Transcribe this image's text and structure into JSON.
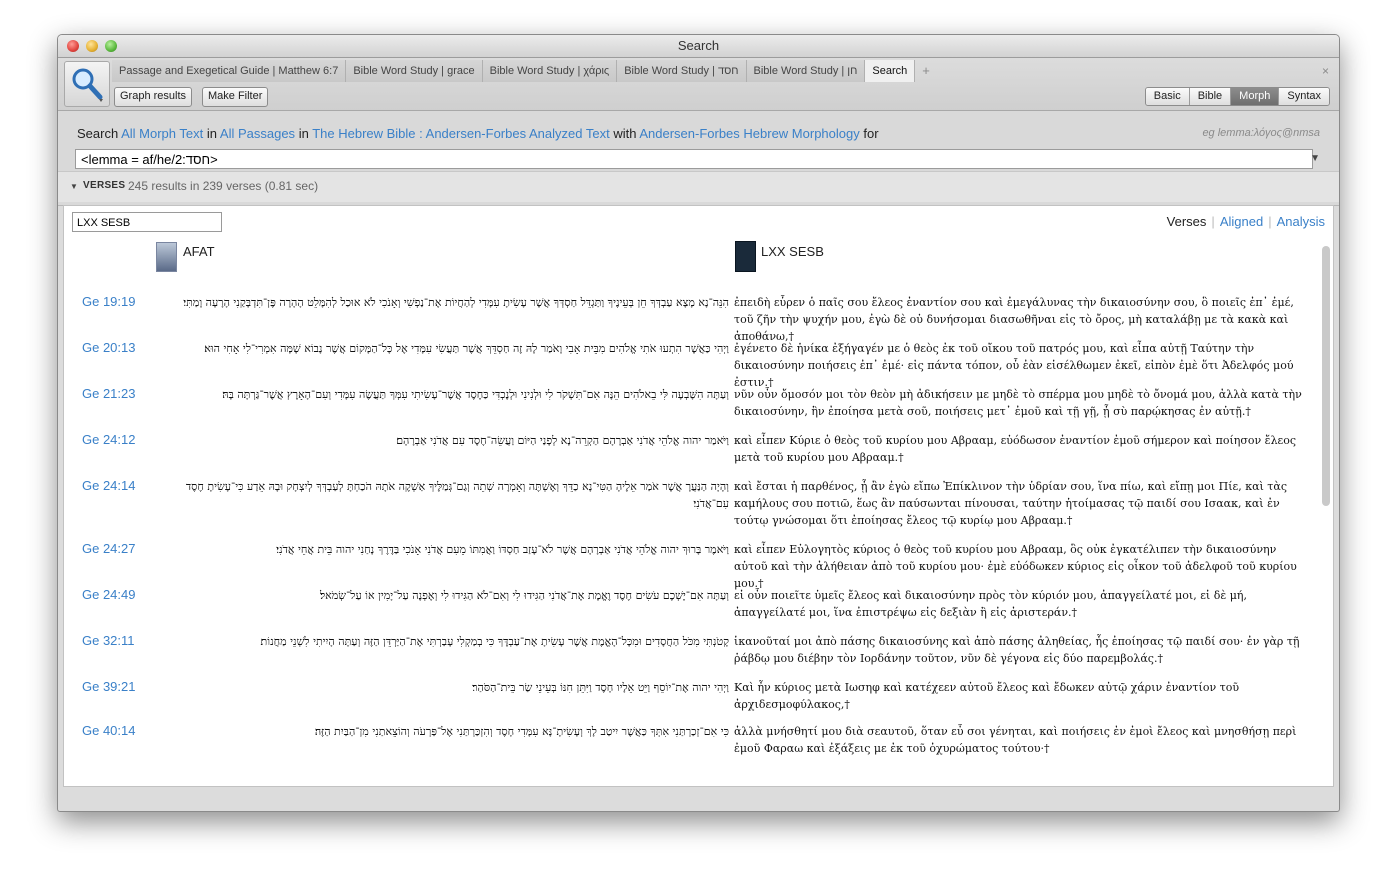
{
  "window": {
    "title": "Search"
  },
  "tabs": [
    {
      "label": "Passage and Exegetical Guide | Matthew 6:7"
    },
    {
      "label": "Bible Word Study | grace"
    },
    {
      "label": "Bible Word Study | χάρις"
    },
    {
      "label": "Bible Word Study | חסד"
    },
    {
      "label": "Bible Word Study | חן"
    },
    {
      "label": "Search"
    }
  ],
  "tab_add": "+",
  "tab_close": "×",
  "toolbar": {
    "graph_results": "Graph results",
    "make_filter": "Make Filter"
  },
  "search_types": [
    "Basic",
    "Bible",
    "Morph",
    "Syntax"
  ],
  "query": {
    "search": "Search",
    "target": "All Morph Text",
    "in": "in",
    "range": "All Passages",
    "in2": "in",
    "resource": "The Hebrew Bible : Andersen-Forbes Analyzed Text",
    "with": "with",
    "morphology": "Andersen-Forbes Hebrew Morphology",
    "for": "for",
    "example": "eg lemma:λόγος@nmsa",
    "value": "<lemma = af/he/2:חסד>"
  },
  "verses": {
    "label": "VERSES",
    "count": "245 results in 239 verses (0.81 sec)"
  },
  "filter_value": "LXX SESB",
  "views": {
    "verses": "Verses",
    "aligned": "Aligned",
    "analysis": "Analysis"
  },
  "columns": {
    "afat": "AFAT",
    "lxx": "LXX SESB"
  },
  "rows": [
    {
      "ref": "Ge 19:19",
      "heb": "הִנֵּה־נָא מָצָא עַבְדְּךָ חֵן בְּעֵינֶיךָ וַתַּגְדֵּל חַסְדְּךָ אֲשֶׁר עָשִׂיתָ עִמָּדִי לְהַחֲיוֹת אֶת־נַפְשִׁי וְאָנֹכִי לֹא אוּכַל לְהִמָּלֵט הָהָרָה פֶּן־תִּדְבָּקַנִי הָרָעָה וָמַתִּי׃",
      "grk": "ἐπειδὴ εὗρεν ὁ παῖς σου ἔλεος ἐναντίον σου καὶ ἐμεγάλυνας τὴν δικαιοσύνην σου, ὃ ποιεῖς ἐπ᾽ ἐμέ, τοῦ ζῆν τὴν ψυχήν μου, ἐγὼ δὲ οὐ δυνήσομαι διασωθῆναι εἰς τὸ ὄρος, μὴ καταλάβῃ με τὰ κακὰ καὶ ἀποθάνω,†"
    },
    {
      "ref": "Ge 20:13",
      "heb": "וַיְהִי כַּאֲשֶׁר הִתְעוּ אֹתִי אֱלֹהִים מִבֵּית אָבִי וָאֹמַר לָהּ זֶה חַסְדֵּךְ אֲשֶׁר תַּעֲשִׂי עִמָּדִי אֶל כָּל־הַמָּקוֹם אֲשֶׁר נָבוֹא שָׁמָּה אִמְרִי־לִי אָחִי הוּא׃",
      "grk": "ἐγένετο δὲ ἡνίκα ἐξήγαγέν με ὁ θεὸς ἐκ τοῦ οἴκου τοῦ πατρός μου, καὶ εἶπα αὐτῇ Ταύτην τὴν δικαιοσύνην ποιήσεις ἐπ᾽ ἐμέ· εἰς πάντα τόπον, οὗ ἐὰν εἰσέλθωμεν ἐκεῖ, εἰπὸν ἐμὲ ὅτι Ἀδελφός μού ἐστιν.†"
    },
    {
      "ref": "Ge 21:23",
      "heb": "וְעַתָּה הִשָּׁבְעָה לִּי בֵאלֹהִים הֵנָּה אִם־תִּשְׁקֹר לִי וּלְנִינִי וּלְנֶכְדִּי כַּחֶסֶד אֲשֶׁר־עָשִׂיתִי עִמְּךָ תַּעֲשֶׂה עִמָּדִי וְעִם־הָאָרֶץ אֲשֶׁר־גַּרְתָּה בָּהּ׃",
      "grk": "νῦν οὖν ὄμοσόν μοι τὸν θεὸν μὴ ἀδικήσειν με μηδὲ τὸ σπέρμα μου μηδὲ τὸ ὄνομά μου, ἀλλὰ κατὰ τὴν δικαιοσύνην, ἣν ἐποίησα μετὰ σοῦ, ποιήσεις μετ᾽ ἐμοῦ καὶ τῇ γῇ, ᾗ σὺ παρῴκησας ἐν αὐτῇ.†"
    },
    {
      "ref": "Ge 24:12",
      "heb": "וַיֹּאמַר יהוה אֱלֹהֵי אֲדֹנִי אַבְרָהָם הַקְרֵה־נָא לְפָנַי הַיּוֹם וַעֲשֵׂה־חֶסֶד עִם אֲדֹנִי אַבְרָהָם׃",
      "grk": "καὶ εἶπεν Κύριε ὁ θεὸς τοῦ κυρίου μου Αβρααμ, εὐόδωσον ἐναντίον ἐμοῦ σήμερον καὶ ποίησον ἔλεος μετὰ τοῦ κυρίου μου Αβρααμ.†"
    },
    {
      "ref": "Ge 24:14",
      "heb": "וְהָיָה הַנַּעֲרָ אֲשֶׁר אֹמַר אֵלֶיהָ הַטִּי־נָא כַדֵּךְ וְאֶשְׁתֶּה וְאָמְרָה שְׁתֵה וְגַם־גְּמַלֶּיךָ אַשְׁקֶה אֹתָהּ הֹכַחְתָּ לְעַבְדְּךָ לְיִצְחָק וּבָהּ אֵדַע כִּי־עָשִׂיתָ חֶסֶד עִם־אֲדֹנִי׃",
      "grk": "καὶ ἔσται ἡ παρθένος, ᾗ ἂν ἐγὼ εἴπω Ἐπίκλινον τὴν ὑδρίαν σου, ἵνα πίω, καὶ εἴπῃ μοι Πίε, καὶ τὰς καμήλους σου ποτιῶ, ἕως ἂν παύσωνται πίνουσαι, ταύτην ἡτοίμασας τῷ παιδί σου Ισαακ, καὶ ἐν τούτῳ γνώσομαι ὅτι ἐποίησας ἔλεος τῷ κυρίῳ μου Αβρααμ.†"
    },
    {
      "ref": "Ge 24:27",
      "heb": "וַיֹּאמֶר בָּרוּךְ יהוה אֱלֹהֵי אֲדֹנִי אַבְרָהָם אֲשֶׁר לֹא־עָזַב חַסְדּוֹ וַאֲמִתּוֹ מֵעִם אֲדֹנִי אָנֹכִי בַּדֶּרֶךְ נָחַנִי יהוה בֵּית אֲחֵי אֲדֹנִי׃",
      "grk": "καὶ εἶπεν Εὐλογητὸς κύριος ὁ θεὸς τοῦ κυρίου μου Αβρααμ, ὃς οὐκ ἐγκατέλιπεν τὴν δικαιοσύνην αὐτοῦ καὶ τὴν ἀλήθειαν ἀπὸ τοῦ κυρίου μου· ἐμὲ εὐόδωκεν κύριος εἰς οἶκον τοῦ ἀδελφοῦ τοῦ κυρίου μου.†"
    },
    {
      "ref": "Ge 24:49",
      "heb": "וְעַתָּה אִם־יֶשְׁכֶם עֹשִׂים חֶסֶד וֶאֱמֶת אֶת־אֲדֹנִי הַגִּידוּ לִי וְאִם־לֹא הַגִּידוּ לִי וְאֶפְנֶה עַל־יָמִין אוֹ עַל־שְׂמֹאל׃",
      "grk": "εἰ οὖν ποιεῖτε ὑμεῖς ἔλεος καὶ δικαιοσύνην πρὸς τὸν κύριόν μου, ἀπαγγείλατέ μοι, εἰ δὲ μή, ἀπαγγείλατέ μοι, ἵνα ἐπιστρέψω εἰς δεξιὰν ἢ εἰς ἀριστεράν.†"
    },
    {
      "ref": "Ge 32:11",
      "heb": "קָטֹנְתִּי מִכֹּל הַחֲסָדִים וּמִכָּל־הָאֱמֶת אֲשֶׁר עָשִׂיתָ אֶת־עַבְדֶּךָ כִּי בְמַקְלִי עָבַרְתִּי אֶת־הַיַּרְדֵּן הַזֶּה וְעַתָּה הָיִיתִי לִשְׁנֵי מַחֲנוֹת׃",
      "grk": "ἱκανοῦταί μοι ἀπὸ πάσης δικαιοσύνης καὶ ἀπὸ πάσης ἀληθείας, ἧς ἐποίησας τῷ παιδί σου· ἐν γὰρ τῇ ῥάβδῳ μου διέβην τὸν Ιορδάνην τοῦτον, νῦν δὲ γέγονα εἰς δύο παρεμβολάς.†"
    },
    {
      "ref": "Ge 39:21",
      "heb": "וַיְהִי יהוה אֶת־יוֹסֵף וַיֵּט אֵלָיו חָסֶד וַיִּתֵּן חִנּוֹ בְּעֵינֵי שַׂר בֵּית־הַסֹּהַר׃",
      "grk": "Καὶ ἦν κύριος μετὰ Ιωσηφ καὶ κατέχεεν αὐτοῦ ἔλεος καὶ ἔδωκεν αὐτῷ χάριν ἐναντίον τοῦ ἀρχιδεσμοφύλακος,†"
    },
    {
      "ref": "Ge 40:14",
      "heb": "כִּי אִם־זְכַרְתַּנִי אִתְּךָ כַּאֲשֶׁר יִיטַב לָךְ וְעָשִׂיתָ־נָּא עִמָּדִי חָסֶד וְהִזְכַּרְתַּנִי אֶל־פַּרְעֹה וְהוֹצֵאתַנִי מִן־הַבַּיִת הַזֶּה׃",
      "grk": "ἀλλὰ μνήσθητί μου διὰ σεαυτοῦ, ὅταν εὖ σοι γένηται, καὶ ποιήσεις ἐν ἐμοὶ ἔλεος καὶ μνησθήσῃ περὶ ἐμοῦ Φαραω καὶ ἐξάξεις με ἐκ τοῦ ὀχυρώματος τούτου·†"
    }
  ]
}
